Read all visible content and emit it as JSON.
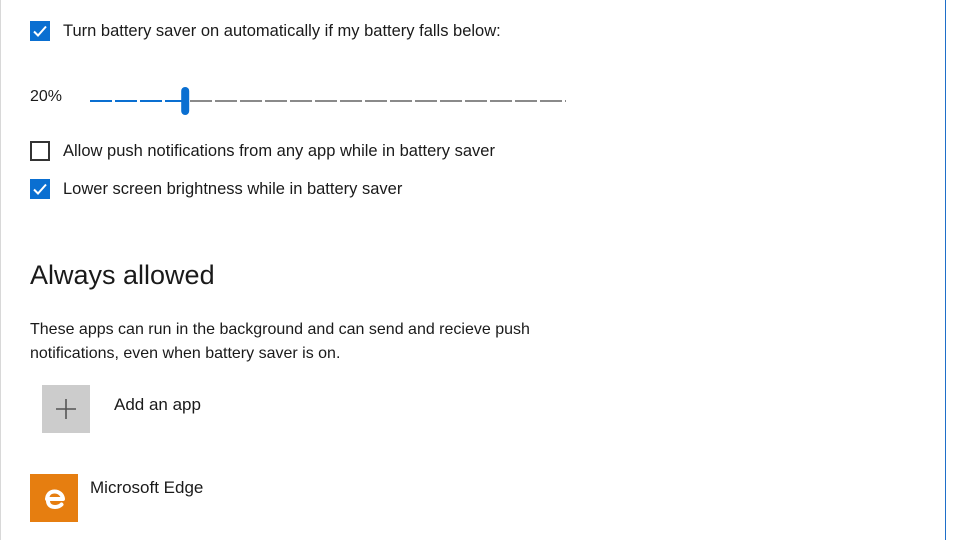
{
  "battery_saver": {
    "auto_on": {
      "label": "Turn battery saver on automatically if my battery falls below:",
      "checked": true
    },
    "threshold": {
      "value_text": "20%",
      "percent": 20
    },
    "push_notifications": {
      "label": "Allow push notifications from any app while in battery saver",
      "checked": false
    },
    "lower_brightness": {
      "label": "Lower screen brightness while in battery saver",
      "checked": true
    }
  },
  "always_allowed": {
    "title": "Always allowed",
    "description": "These apps can run in the background and can send and recieve push notifications, even when battery saver is on.",
    "add_app_label": "Add an app",
    "apps": [
      {
        "name": "Microsoft Edge",
        "icon": "edge-icon",
        "color": "#e67e10"
      }
    ]
  },
  "colors": {
    "accent": "#0a6fd1"
  }
}
